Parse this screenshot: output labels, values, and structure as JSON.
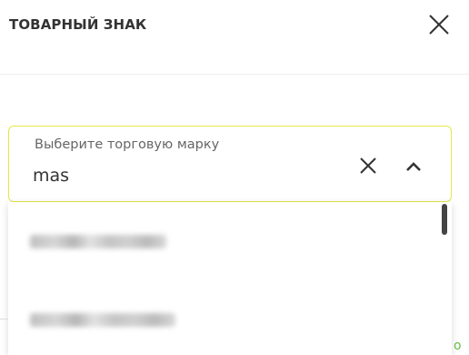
{
  "header": {
    "title": "ТОВАРНЫЙ ЗНАК",
    "close_icon": "close-icon"
  },
  "select": {
    "label": "Выберите торговую марку",
    "value": "mas",
    "clear_icon": "clear-icon",
    "toggle_icon": "chevron-up-icon",
    "border_color": "#e6e64a"
  },
  "dropdown": {
    "options_visible": 2
  },
  "underlay": {
    "partial_text": "о"
  },
  "colors": {
    "accent_border": "#e6e64a",
    "link_green": "#6aba4a",
    "text": "#333333"
  }
}
